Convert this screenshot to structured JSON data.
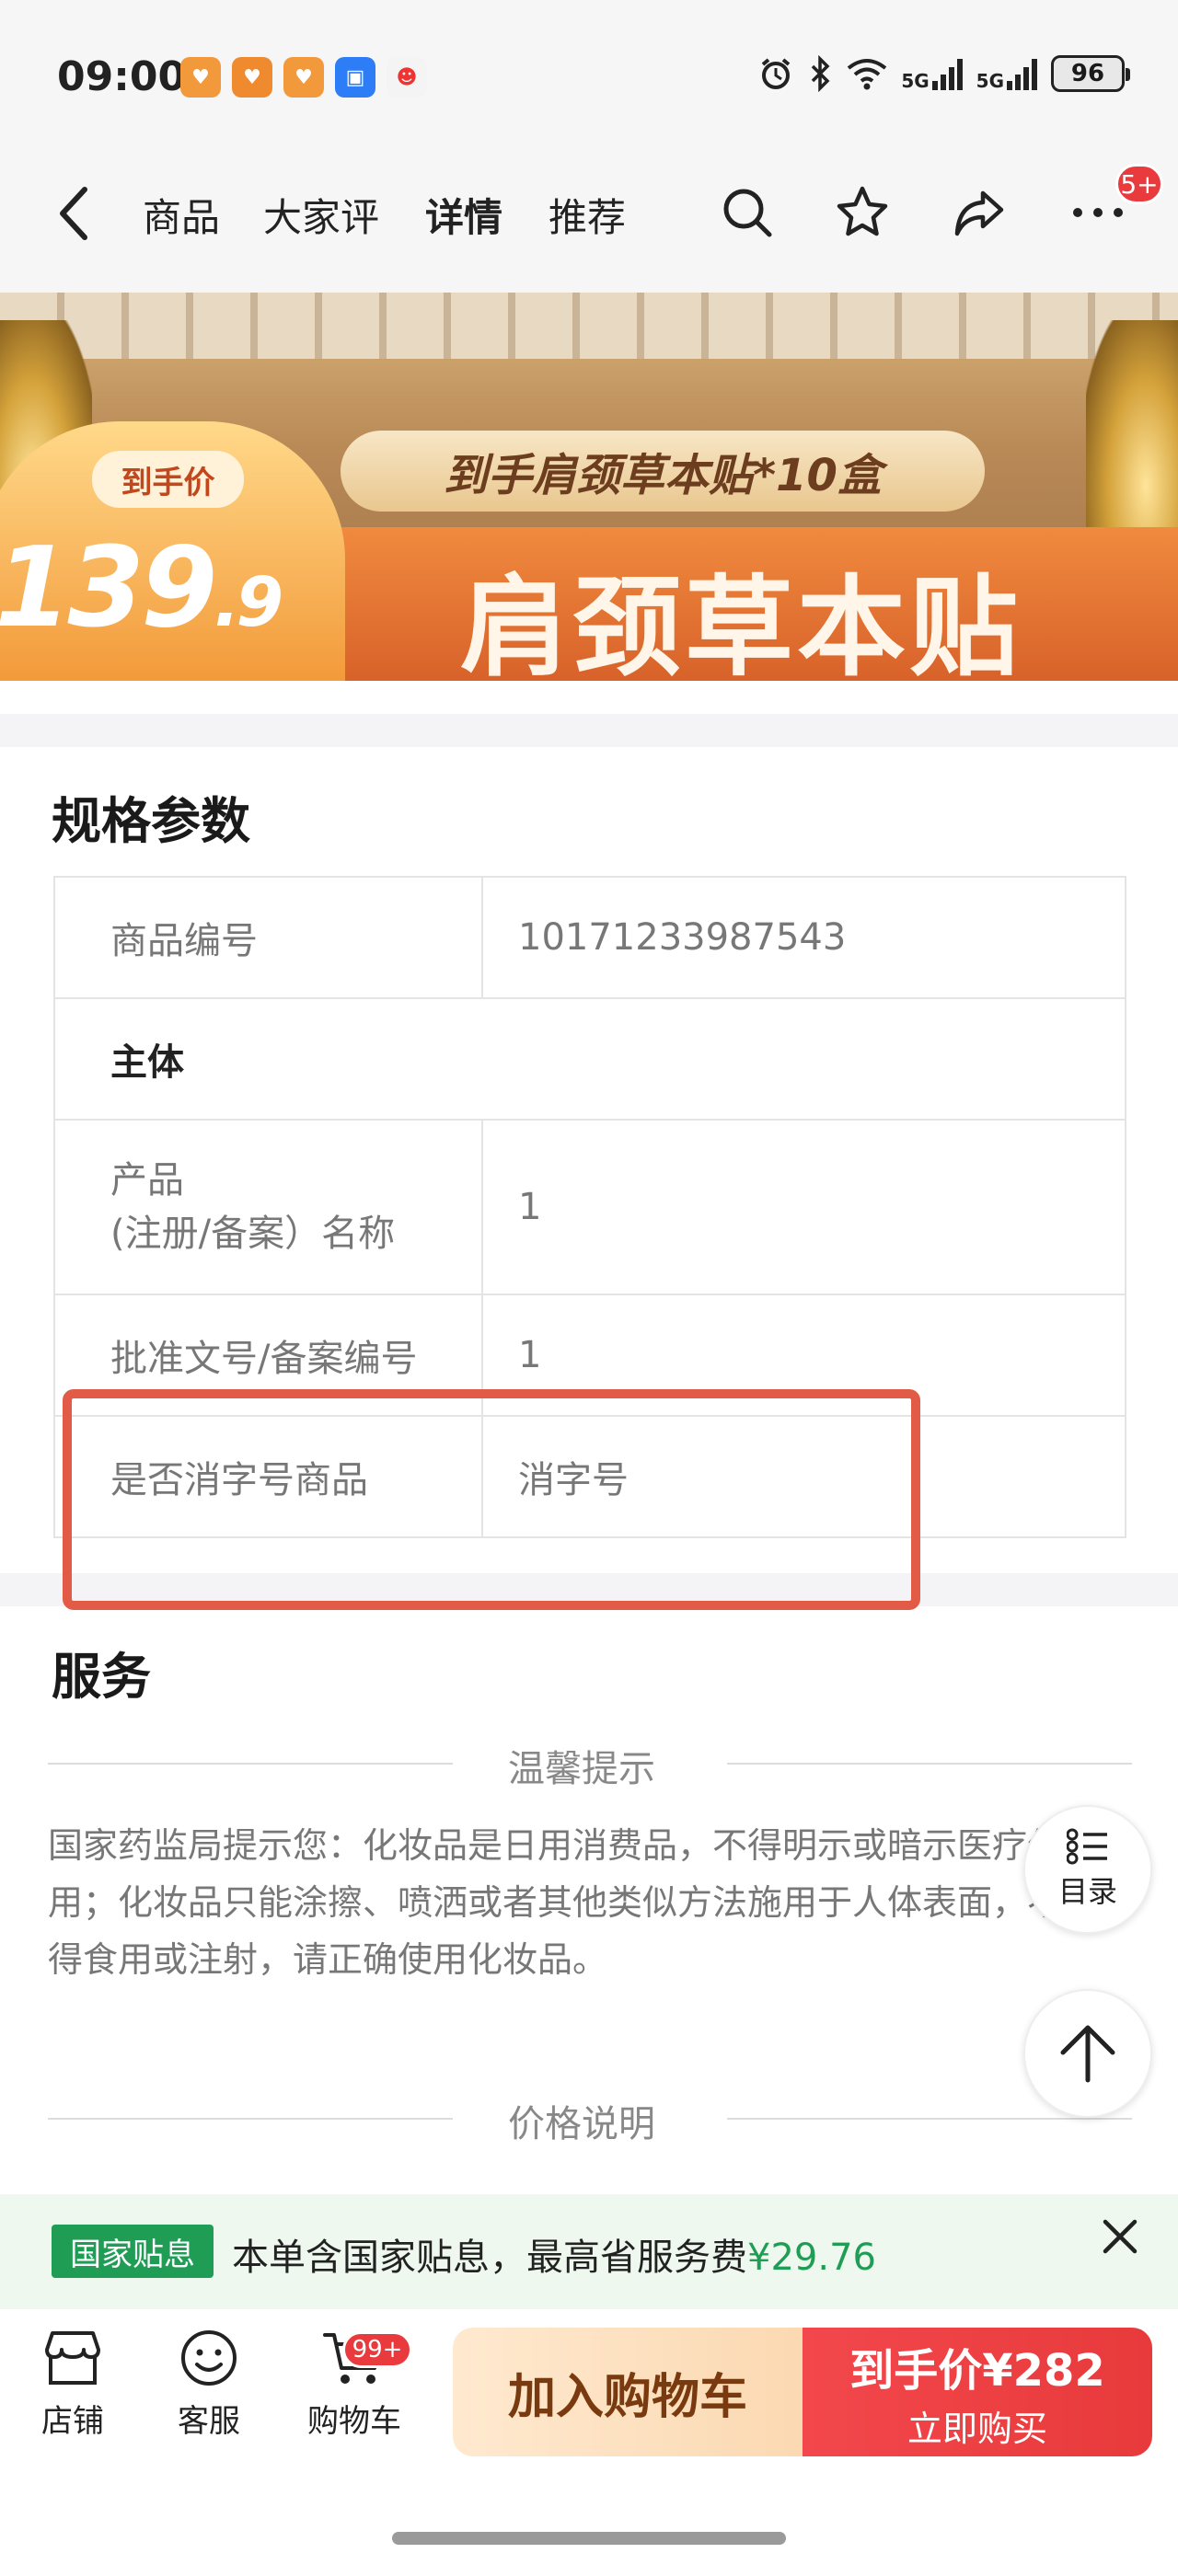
{
  "status": {
    "time": "09:00",
    "net1": "5G",
    "net2": "5G",
    "battery": "96"
  },
  "nav": {
    "tabs": [
      "商品",
      "大家评",
      "详情",
      "推荐"
    ],
    "active": "详情",
    "more_badge": "5+"
  },
  "banner": {
    "hand_label": "到手价",
    "hand_price_int": "139",
    "hand_price_dec": ".9",
    "subtitle": "到手肩颈草本贴*10盒",
    "title": "肩颈草本贴"
  },
  "spec": {
    "section_title": "规格参数",
    "rows": [
      {
        "key": "商品编号",
        "value": "10171233987543"
      },
      {
        "group": "主体"
      },
      {
        "key_line1": "产品",
        "key_line2": "(注册/备案）名称",
        "value": "1"
      },
      {
        "key": "批准文号/备案编号",
        "value": "1"
      },
      {
        "key": "是否消字号商品",
        "value": "消字号"
      }
    ]
  },
  "service": {
    "section_title": "服务",
    "tip_heading": "温馨提示",
    "tip_text": "国家药监局提示您：化妆品是日用消费品，不得明示或暗示医疗作用；化妆品只能涂擦、喷洒或者其他类似方法施用于人体表面，不得食用或注射，请正确使用化妆品。",
    "price_heading": "价格说明"
  },
  "float": {
    "toc_label": "目录"
  },
  "subsidy": {
    "tag": "国家贴息",
    "text_prefix": "本单含国家贴息，最高省服务费",
    "amount": "¥29.76"
  },
  "bottom": {
    "store": "店铺",
    "service": "客服",
    "cart": "购物车",
    "cart_badge": "99+",
    "add_cart": "加入购物车",
    "buy_line1": "到手价¥282",
    "buy_line2": "立即购买"
  },
  "colors": {
    "accent_red": "#e93b3d",
    "highlight_box": "#e25b47",
    "subsidy_green": "#1f9d55"
  }
}
